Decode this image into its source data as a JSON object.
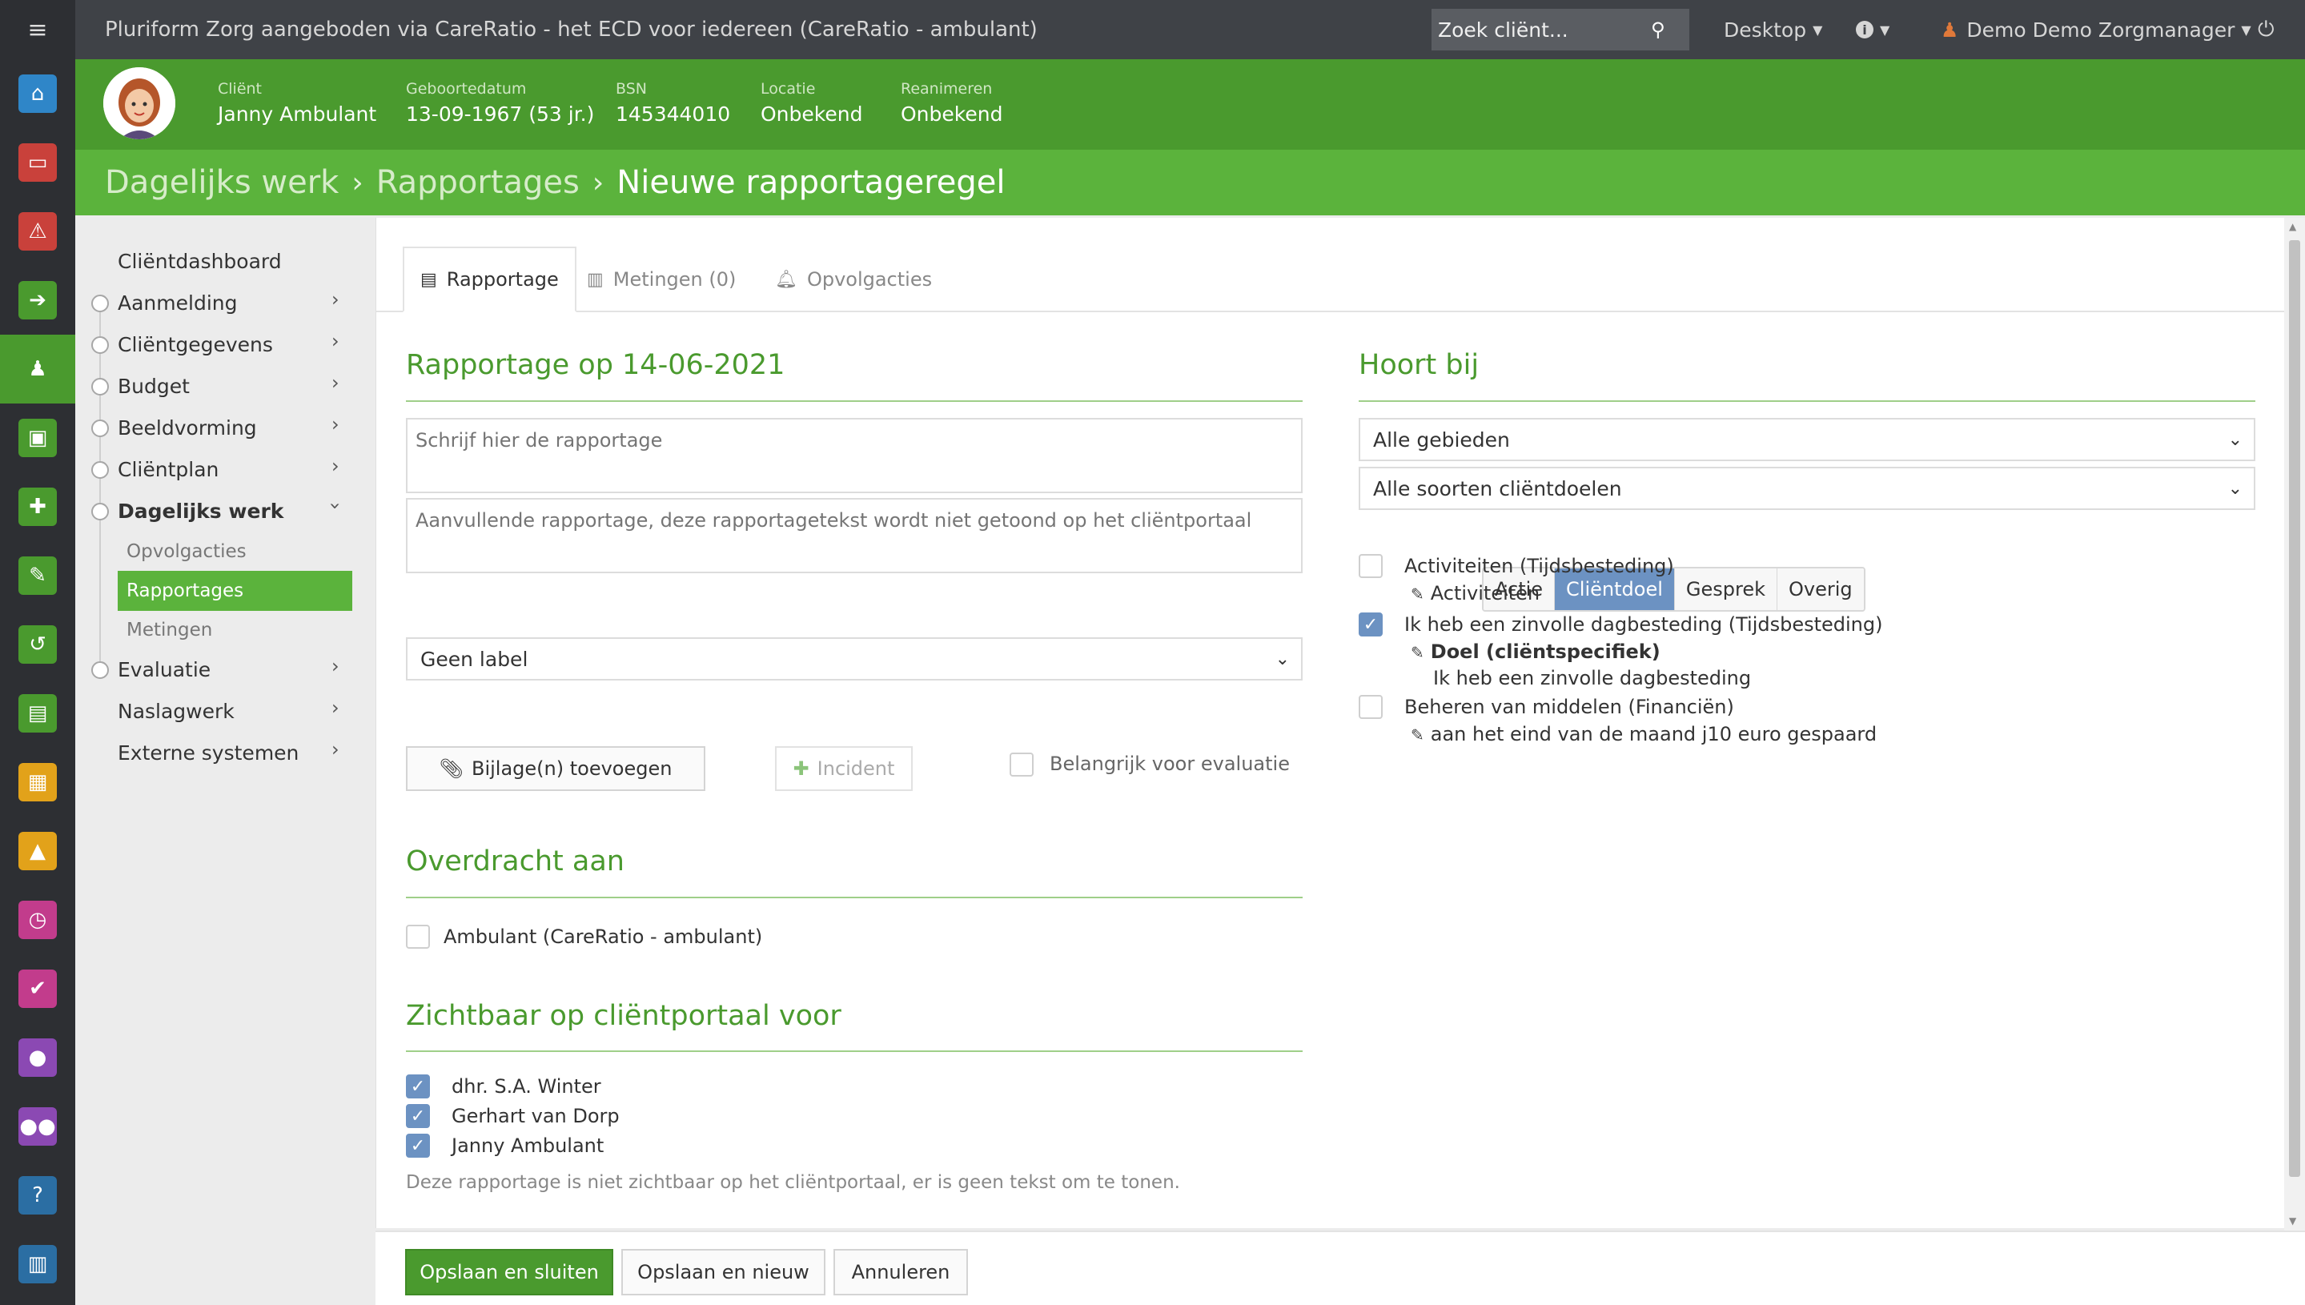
{
  "app": {
    "title": "Pluriform Zorg aangeboden via CareRatio - het ECD voor iedereen  (CareRatio - ambulant)",
    "search_placeholder": "Zoek cliënt...",
    "desktop_label": "Desktop",
    "user_label": "Demo Demo Zorgmanager"
  },
  "rail": {
    "items": [
      {
        "name": "home-icon",
        "color": "#2f86c8",
        "glyph": "⌂"
      },
      {
        "name": "inbox-icon",
        "color": "#c9413b",
        "glyph": "▭"
      },
      {
        "name": "warning-icon",
        "color": "#c9413b",
        "glyph": "⚠"
      },
      {
        "name": "signin-icon",
        "color": "#4a9a2e",
        "glyph": "➔"
      },
      {
        "name": "client-icon",
        "color": "#4a9a2e",
        "glyph": "♟"
      },
      {
        "name": "money-icon",
        "color": "#4a9a2e",
        "glyph": "▣"
      },
      {
        "name": "puzzle-icon",
        "color": "#4a9a2e",
        "glyph": "✚"
      },
      {
        "name": "pencil-icon",
        "color": "#4a9a2e",
        "glyph": "✎"
      },
      {
        "name": "undo-icon",
        "color": "#4a9a2e",
        "glyph": "↺"
      },
      {
        "name": "document-icon",
        "color": "#4a9a2e",
        "glyph": "▤"
      },
      {
        "name": "calendar-icon",
        "color": "#e2a21a",
        "glyph": "▦"
      },
      {
        "name": "road-icon",
        "color": "#e2a21a",
        "glyph": "▲"
      },
      {
        "name": "clock-icon",
        "color": "#c23c8c",
        "glyph": "◷"
      },
      {
        "name": "check-icon",
        "color": "#c23c8c",
        "glyph": "✔"
      },
      {
        "name": "user-icon",
        "color": "#8b49b3",
        "glyph": "●"
      },
      {
        "name": "group-icon",
        "color": "#8b49b3",
        "glyph": "●●"
      },
      {
        "name": "help-icon",
        "color": "#2b6ea3",
        "glyph": "?"
      },
      {
        "name": "chart-icon",
        "color": "#2b6ea3",
        "glyph": "▥"
      }
    ]
  },
  "client": {
    "name_label": "Cliënt",
    "name": "Janny Ambulant",
    "dob_label": "Geboortedatum",
    "dob": "13-09-1967 (53 jr.)",
    "bsn_label": "BSN",
    "bsn": "145344010",
    "location_label": "Locatie",
    "location": "Onbekend",
    "resus_label": "Reanimeren",
    "resus": "Onbekend"
  },
  "breadcrumb": {
    "level1": "Dagelijks werk",
    "level2": "Rapportages",
    "current": "Nieuwe rapportageregel"
  },
  "sidenav": {
    "items": [
      "Cliëntdashboard",
      "Aanmelding",
      "Cliëntgegevens",
      "Budget",
      "Beeldvorming",
      "Cliëntplan",
      "Dagelijks werk",
      "Evaluatie",
      "Naslagwerk",
      "Externe systemen"
    ],
    "sub_items": [
      "Opvolgacties",
      "Rapportages",
      "Metingen"
    ]
  },
  "tabs": {
    "rapportage": "Rapportage",
    "metingen": "Metingen (0)",
    "opvolgacties": "Opvolgacties"
  },
  "form": {
    "title": "Rapportage op 14-06-2021",
    "text_placeholder": "Schrijf hier de rapportage",
    "extra_placeholder": "Aanvullende rapportage, deze rapportagetekst wordt niet getoond op het cliëntportaal",
    "label_select": "Geen label",
    "attach_button": "Bijlage(n) toevoegen",
    "incident_button": "Incident",
    "important_label": "Belangrijk voor evaluatie",
    "transfer_title": "Overdracht aan",
    "transfer_option": "Ambulant (CareRatio - ambulant)",
    "portal_title": "Zichtbaar op cliëntportaal voor",
    "portal_people": [
      "dhr. S.A. Winter",
      "Gerhart van Dorp",
      "Janny Ambulant"
    ],
    "portal_note": "Deze rapportage is niet zichtbaar op het cliëntportaal, er is geen tekst om te tonen."
  },
  "belongs": {
    "title": "Hoort bij",
    "segments": [
      "Actie",
      "Cliëntdoel",
      "Gesprek",
      "Overig"
    ],
    "active_segment": "Cliëntdoel",
    "area_select": "Alle gebieden",
    "type_select": "Alle soorten cliëntdoelen",
    "goals": [
      {
        "title": "Activiteiten (Tijdsbesteding)",
        "sub": "Activiteiten",
        "checked": false
      },
      {
        "title": "Ik heb een zinvolle dagbesteding (Tijdsbesteding)",
        "sub": "Doel (cliëntspecifiek)",
        "sub2": "Ik heb een zinvolle dagbesteding",
        "checked": true
      },
      {
        "title": "Beheren van middelen (Financiën)",
        "sub": "aan het eind van de maand j10 euro gespaard",
        "checked": false
      }
    ]
  },
  "footer": {
    "save_close": "Opslaan en sluiten",
    "save_new": "Opslaan en nieuw",
    "cancel": "Annuleren"
  },
  "colors": {
    "brand_green": "#4a9a2e",
    "crumb_green": "#5bb33c",
    "accent_blue": "#6c92c2"
  }
}
